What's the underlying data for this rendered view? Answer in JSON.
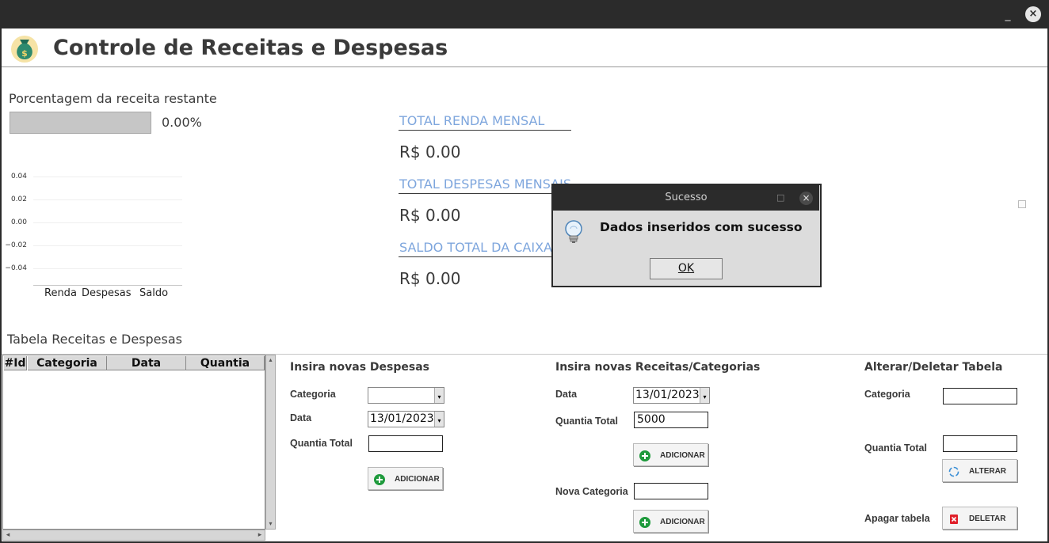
{
  "window": {
    "minimize_glyph": "_",
    "close_glyph": "×"
  },
  "header": {
    "title": "Controle de Receitas e Despesas",
    "logo_icon": "money-bag-icon",
    "logo_glyph": "$"
  },
  "progress": {
    "label": "Porcentagem da receita restante",
    "value": 0,
    "value_text": "0.00%"
  },
  "chart_data": {
    "type": "bar",
    "categories": [
      "Renda",
      "Despesas",
      "Saldo"
    ],
    "values": [
      0,
      0,
      0
    ],
    "ylim": [
      -0.05,
      0.05
    ],
    "yticks": [
      "0.04",
      "0.02",
      "0.00",
      "−0.02",
      "−0.04"
    ],
    "title": "",
    "xlabel": "",
    "ylabel": ""
  },
  "totals": [
    {
      "label": "TOTAL RENDA MENSAL",
      "value": "R$ 0.00"
    },
    {
      "label": "TOTAL DESPESAS MENSAIS",
      "value": "R$ 0.00"
    },
    {
      "label": "SALDO TOTAL DA CAIXA",
      "value": "R$ 0.00"
    }
  ],
  "table": {
    "label": "Tabela Receitas e Despesas",
    "columns": [
      "#Id",
      "Categoria",
      "Data",
      "Quantia"
    ],
    "scroll_left": "◂",
    "scroll_right": "▸",
    "scroll_up": "▴",
    "scroll_down": "▾"
  },
  "despesas": {
    "title": "Insira novas Despesas",
    "categoria_label": "Categoria",
    "categoria_value": "",
    "data_label": "Data",
    "data_value": "13/01/2023",
    "quantia_label": "Quantia Total",
    "quantia_value": "",
    "add_label": "ADICIONAR"
  },
  "receitas": {
    "title": "Insira novas Receitas/Categorias",
    "data_label": "Data",
    "data_value": "13/01/2023",
    "quantia_label": "Quantia Total",
    "quantia_value": "5000",
    "add_label": "ADICIONAR",
    "nova_categoria_label": "Nova Categoria",
    "nova_categoria_value": "",
    "add_categoria_label": "ADICIONAR"
  },
  "alterar": {
    "title": "Alterar/Deletar Tabela",
    "categoria_label": "Categoria",
    "categoria_value": "",
    "quantia_label": "Quantia Total",
    "quantia_value": "",
    "alterar_label": "ALTERAR",
    "apagar_label": "Apagar tabela",
    "deletar_label": "DELETAR"
  },
  "dialog": {
    "title": "Sucesso",
    "message": "Dados inseridos com sucesso",
    "ok_label": "OK",
    "icon": "lightbulb-icon",
    "close_glyph": "×",
    "maximize_glyph": "□"
  },
  "colors": {
    "accent_blue": "#7ea6dd",
    "titlebar": "#2b2b2b",
    "add_green": "#1e9a3c",
    "delete_red": "#e0202a"
  }
}
